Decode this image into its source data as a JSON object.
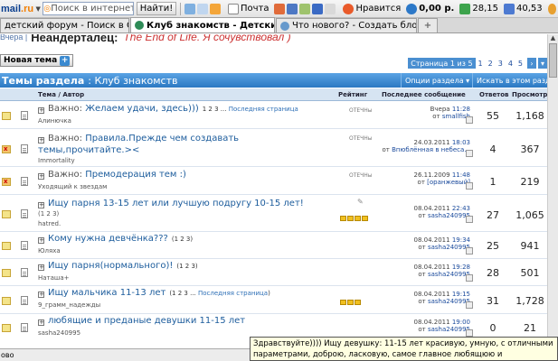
{
  "toolbar": {
    "logo": "mail",
    "logo_suffix": ".ru",
    "search_placeholder": "Поиск в интернете",
    "find_button": "Найти!",
    "mail_label": "Почта",
    "like_label": "Нравится",
    "money": "0,00 р.",
    "usd": "28,15",
    "eur": "40,53"
  },
  "tabs": [
    {
      "label": "детский форум - Поиск в Go...",
      "active": false
    },
    {
      "label": "Клуб знакомств - Детски...",
      "active": true
    },
    {
      "label": "Что нового? - Создать блог ...",
      "active": false
    }
  ],
  "crumb": {
    "small": "Вчера |",
    "title": "Неандерталец:",
    "italic": "The End of Life. Я сочувствовал )"
  },
  "new_topic": "Новая тема",
  "pager": {
    "current": "Страница 1 из 5",
    "pages": [
      "1",
      "2",
      "3",
      "4",
      "5"
    ]
  },
  "section": {
    "title": "Темы раздела",
    "sub": ": Клуб знакомств",
    "options": "Опции раздела",
    "search": "Искать в этом разделе"
  },
  "columns": {
    "topic": "Тема / Автор",
    "rating": "Рейтинг",
    "last": "Последнее сообщение",
    "answers": "Ответов",
    "views": "Просмотров"
  },
  "rows": [
    {
      "pre": "Важно:",
      "title": "Желаем удачи, здесь)))",
      "pages": "1 2 3 ...",
      "last_page": "Последняя страница",
      "author": "Алинючка",
      "rating_label": "ОТЕЧНы",
      "date": "Вчера",
      "time": "11:28",
      "user": "smallfish",
      "answers": "55",
      "views": "1,168"
    },
    {
      "pre": "Важно:",
      "title": "Правила.Прежде чем создавать",
      "title2": "темы,прочитайте.><",
      "author": "Immortality",
      "rating_label": "ОТЕЧНы",
      "date": "24.03.2011",
      "time": "18:03",
      "user": "Впюблённая в небеса...",
      "answers": "4",
      "views": "367"
    },
    {
      "pre": "Важно:",
      "title": "Премодерация тем :)",
      "author": "Уходящий к звездам",
      "rating_label": "ОТЕЧНы",
      "date": "26.11.2009",
      "time": "11:48",
      "user": "[оранжевый]",
      "answers": "1",
      "views": "219"
    },
    {
      "title": "Ищу парня 13-15 лет или лучшую подругу 10-15 лет!",
      "pages": "1 2 3",
      "author": "hatred.",
      "date": "08.04.2011",
      "time": "22:43",
      "user": "sasha240995",
      "answers": "27",
      "views": "1,065"
    },
    {
      "title": "Кому нужна девчёнка???",
      "pages": "1 2 3",
      "author": "Юляха",
      "date": "08.04.2011",
      "time": "19:34",
      "user": "sasha240995",
      "answers": "25",
      "views": "941"
    },
    {
      "title": "Ищу парня(нормального)!",
      "pages": "1 2 3",
      "author": "Наташа+",
      "date": "08.04.2011",
      "time": "19:28",
      "user": "sasha240995",
      "answers": "28",
      "views": "501"
    },
    {
      "title": "Ищу мальчика 11-13 лет",
      "pages": "1 2 3 ...",
      "last_page": "Последняя страница",
      "author": "9_грамм_надежды",
      "date": "08.04.2011",
      "time": "19:15",
      "user": "sasha240995",
      "answers": "31",
      "views": "1,728"
    },
    {
      "title": "любящие и преданые девушки 11-15 лет",
      "author": "sasha240995",
      "date": "08.04.2011",
      "time": "19:00",
      "user": "sasha240995",
      "answers": "0",
      "views": "21"
    }
  ],
  "status": "ово",
  "tooltip": "Здравствуйте)))) Ищу девушку: 11-15 лет красивую, умную, с отличными параметрами, доброю, ласковую, самое главное любящюю и преданую!!! Которая"
}
